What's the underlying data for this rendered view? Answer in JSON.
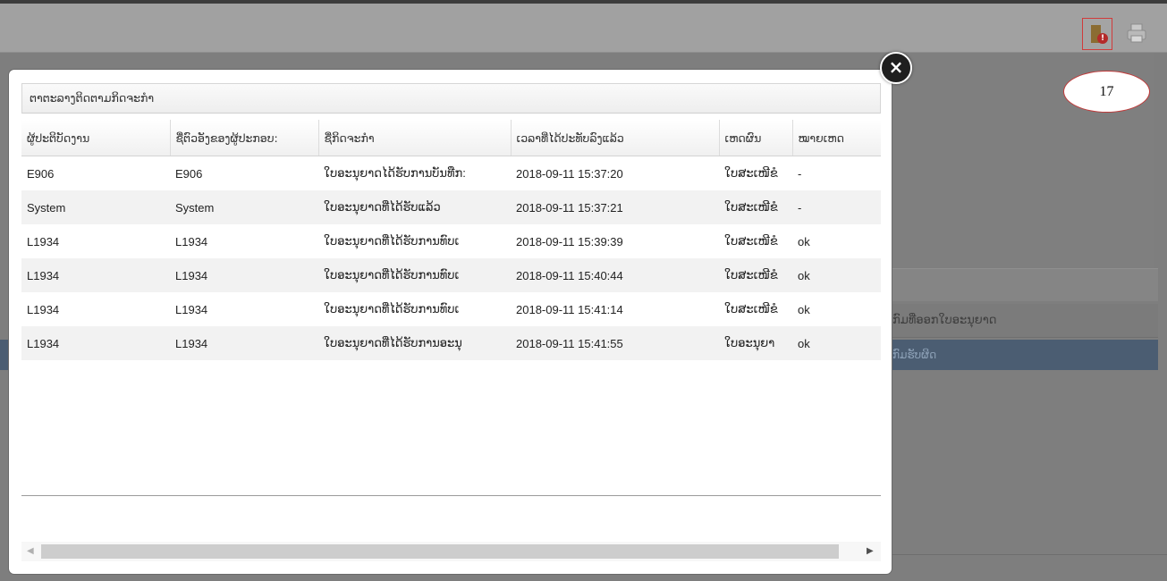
{
  "background": {
    "side_items": [
      "ກົມທີ່ອອກໃບອະນຸຍາດ",
      "ກົມຮັບຜິດ"
    ]
  },
  "toolbar": {
    "icons": [
      "warning-document-icon",
      "printer-icon"
    ]
  },
  "annotation": {
    "callout_number": "17"
  },
  "modal": {
    "close_icon": "×",
    "panel_title": "ຕາຕະລາງຕິດຕາມກິດຈະກໍາ",
    "columns": [
      "ຜູ້ປະຕິບັດງານ",
      "ຊື່ຕົວອັງຂອງຜູ້ປະກອບ:",
      "ຊື່ກິດຈະກໍາ",
      "ເວລາທີ່ໄດ້ປະທັບລົງແລ້ວ",
      "ເຫດຜົນ",
      "ໝາຍເຫດ"
    ],
    "rows": [
      [
        "E906",
        "E906",
        "ໃບອະນຸຍາດໄດ້ຮັບການບັນທືກ:",
        "2018-09-11 15:37:20",
        "ໃບສະເໜີຂໍ",
        "-"
      ],
      [
        "System",
        "System",
        "ໃບອະນຸຍາດທີ່ໄດ້ຮັບແລ້ວ",
        "2018-09-11 15:37:21",
        "ໃບສະເໜີຂໍ",
        "-"
      ],
      [
        "L1934",
        "L1934",
        "ໃບອະນຸຍາດທີ່ໄດ້ຮັບການທົບເ",
        "2018-09-11 15:39:39",
        "ໃບສະເໜີຂໍ",
        "ok"
      ],
      [
        "L1934",
        "L1934",
        "ໃບອະນຸຍາດທີ່ໄດ້ຮັບການທົບເ",
        "2018-09-11 15:40:44",
        "ໃບສະເໜີຂໍ",
        "ok"
      ],
      [
        "L1934",
        "L1934",
        "ໃບອະນຸຍາດທີ່ໄດ້ຮັບການທົບເ",
        "2018-09-11 15:41:14",
        "ໃບສະເໜີຂໍ",
        "ok"
      ],
      [
        "L1934",
        "L1934",
        "ໃບອະນຸຍາດທີ່ໄດ້ຮັບການອະນຸ",
        "2018-09-11 15:41:55",
        "ໃບອະນຸຍາ",
        "ok"
      ]
    ],
    "scrollbar": {
      "left_arrow": "◀",
      "right_arrow": "▶"
    }
  }
}
